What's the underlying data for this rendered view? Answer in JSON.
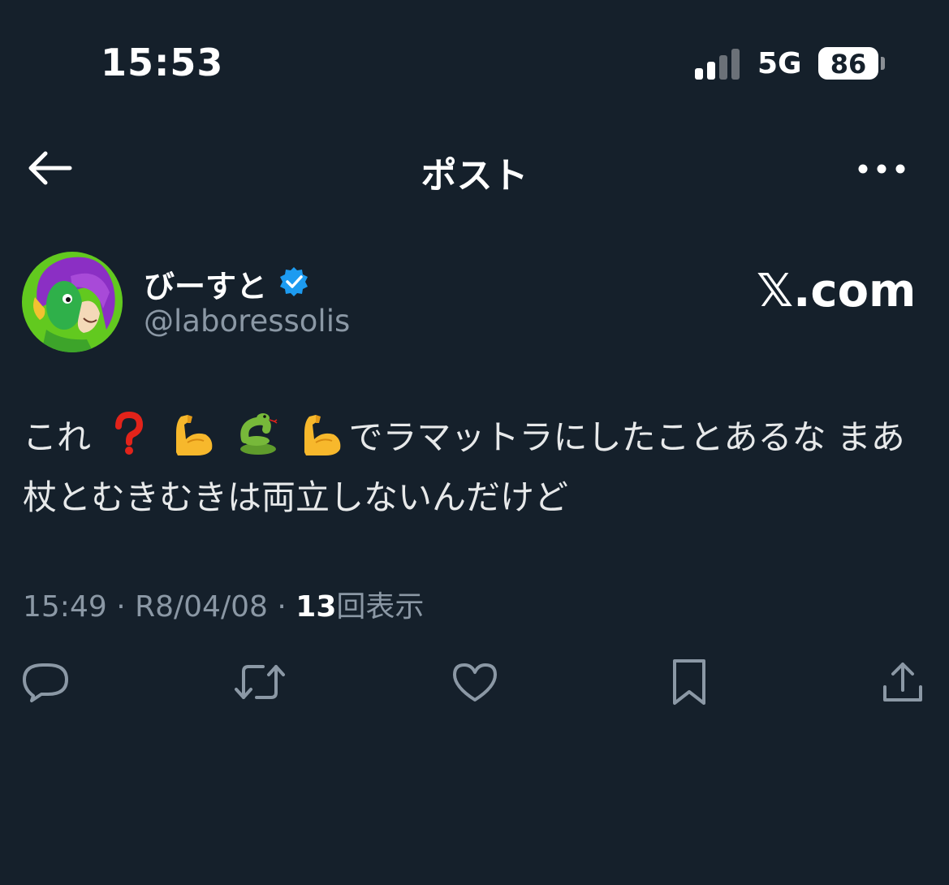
{
  "status_bar": {
    "time": "15:53",
    "network": "5G",
    "battery": "86"
  },
  "header": {
    "title": "ポスト",
    "back_icon": "arrow-left-icon",
    "more_icon": "more-horizontal-icon"
  },
  "author": {
    "display_name": "びーすと",
    "handle": "@laboressolis",
    "verified": true,
    "verified_color": "#1d9bf0"
  },
  "watermark": "𝕏.com",
  "post": {
    "text_before": "これ",
    "emojis": [
      "question-mark-emoji",
      "flexed-biceps-emoji",
      "snake-emoji",
      "flexed-biceps-emoji"
    ],
    "text_after": "でラマットラにしたことあるな まあ杖とむきむきは両立しないんだけど"
  },
  "meta": {
    "time": "15:49",
    "separator": "·",
    "date": "R8/04/08",
    "views_count": "13",
    "views_label": "回表示"
  },
  "actions": [
    "reply-icon",
    "retweet-icon",
    "like-icon",
    "bookmark-icon",
    "share-icon"
  ],
  "colors": {
    "background": "#15202b",
    "text": "#e7e9ea",
    "secondary": "#8b98a5"
  }
}
